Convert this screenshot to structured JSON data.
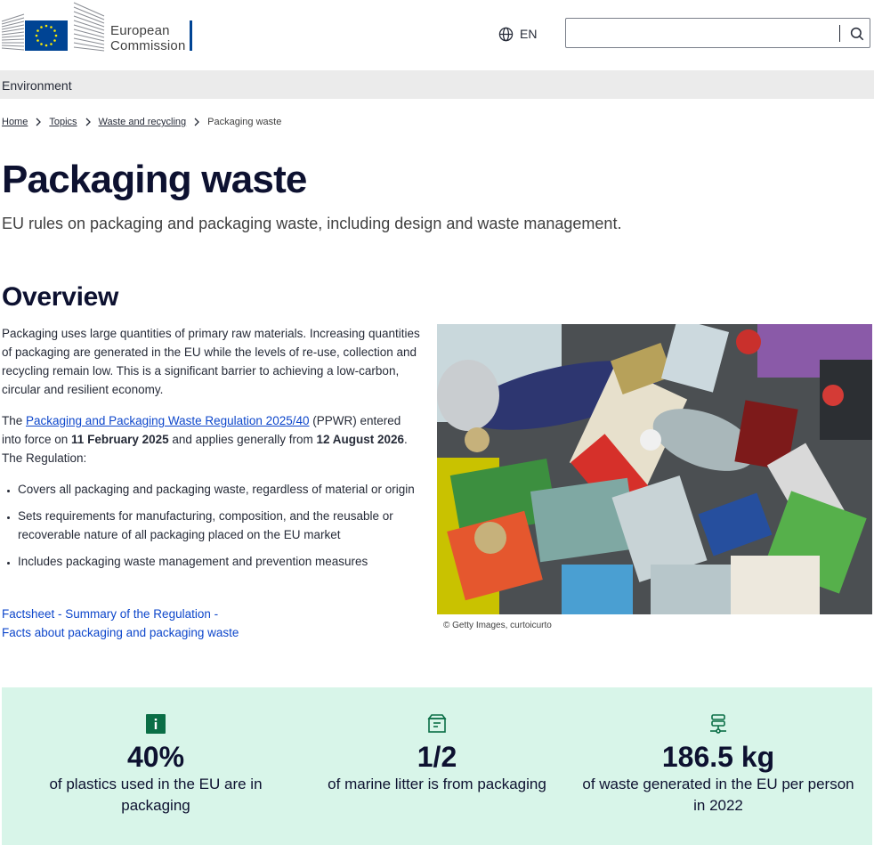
{
  "header": {
    "logo_line1": "European",
    "logo_line2": "Commission",
    "language_code": "EN",
    "search_placeholder": ""
  },
  "site": {
    "name": "Environment"
  },
  "breadcrumb": {
    "items": [
      "Home",
      "Topics",
      "Waste and recycling"
    ],
    "current": "Packaging waste"
  },
  "page": {
    "title": "Packaging waste",
    "lead": "EU rules on packaging and packaging waste, including design and waste management."
  },
  "overview": {
    "heading": "Overview",
    "paragraph1": "Packaging uses large quantities of primary raw materials. Increasing quantities of packaging are generated in the EU while the levels of re-use, collection and recycling remain low.  This is a significant barrier to achieving a low-carbon, circular and resilient economy.",
    "p2_before": "The ",
    "p2_link": "Packaging and Packaging Waste Regulation 2025/40",
    "p2_middle1": " (PPWR) entered into force on ",
    "p2_date1": "11 February 2025",
    "p2_middle2": " and applies generally from ",
    "p2_date2": "12 August 2026",
    "p2_after": ". The Regulation:",
    "bullets": [
      "Covers all packaging and packaging waste, regardless of material or origin",
      "Sets requirements for manufacturing, composition, and the reusable or recoverable nature of all packaging placed on the EU market",
      "Includes packaging waste management and prevention measures"
    ],
    "link1": "Factsheet - Summary of the Regulation -",
    "link2": "Facts about packaging and packaging waste",
    "image_caption": "© Getty Images, curtoicurto"
  },
  "stats": [
    {
      "value": "40%",
      "label": "of plastics used in the EU are in packaging",
      "icon": "info-icon"
    },
    {
      "value": "1/2",
      "label": "of marine litter is from packaging",
      "icon": "archive-box-icon"
    },
    {
      "value": "186.5 kg",
      "label": "of waste generated in the EU per person in 2022",
      "icon": "database-icon"
    }
  ],
  "colors": {
    "link": "#0e47cb",
    "title": "#0d1130",
    "site_bar": "#ebebeb",
    "stats_bg": "#d8f5e9",
    "icon_green": "#0a6e46",
    "eu_blue": "#004494",
    "eu_yellow": "#ffed00"
  }
}
